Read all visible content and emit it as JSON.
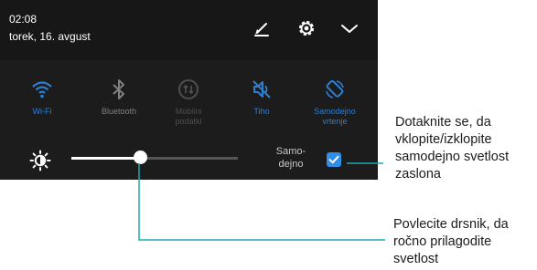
{
  "status": {
    "time": "02:08",
    "date": "torek, 16. avgust"
  },
  "header_icons": [
    "edit-icon",
    "settings-gear-icon",
    "expand-chevron-icon"
  ],
  "quick_settings": [
    {
      "label": "Wi-Fi",
      "icon": "wifi-icon",
      "state": "on"
    },
    {
      "label": "Bluetooth",
      "icon": "bluetooth-icon",
      "state": "off"
    },
    {
      "label": "Mobilni podatki",
      "icon": "mobile-data-icon",
      "state": "disabled"
    },
    {
      "label": "Tiho",
      "icon": "silent-icon",
      "state": "on"
    },
    {
      "label": "Samodejno vrtenje",
      "icon": "auto-rotate-icon",
      "state": "on"
    }
  ],
  "brightness": {
    "icon": "brightness-icon",
    "level": 0.42,
    "auto_label": "Samo-dejno",
    "auto_checked": true
  },
  "annotations": {
    "checkbox_note": "Dotaknite se, da vklopite/izklopite samodejno svetlost zaslona",
    "slider_note": "Povlecite drsnik, da ročno prilagodite svetlost"
  },
  "colors": {
    "panel_bg": "#1c1c1c",
    "header_bg": "#171717",
    "accent": "#2d7fd3",
    "leader_line": "#1fa9b0",
    "inactive": "#808080"
  }
}
